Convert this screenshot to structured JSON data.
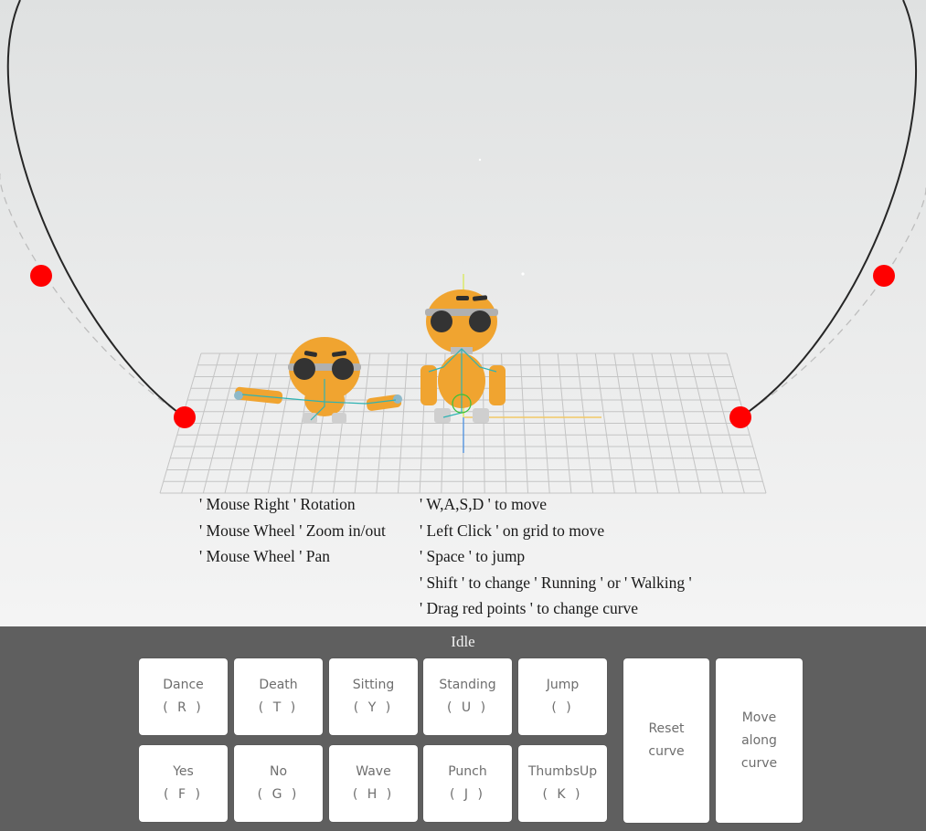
{
  "instructions": {
    "left": [
      "' Mouse Right ' Rotation",
      "' Mouse Wheel ' Zoom in/out",
      "' Mouse Wheel ' Pan"
    ],
    "right": [
      "' W,A,S,D ' to move",
      "' Left Click ' on grid to move",
      "' Space ' to jump",
      "' Shift ' to change ' Running ' or ' Walking '",
      "' Drag red points ' to change curve"
    ]
  },
  "status": "Idle",
  "actions_row1": [
    {
      "label": "Dance",
      "key": "( R )"
    },
    {
      "label": "Death",
      "key": "( T )"
    },
    {
      "label": "Sitting",
      "key": "( Y )"
    },
    {
      "label": "Standing",
      "key": "( U )"
    },
    {
      "label": "Jump",
      "key": "(  )"
    }
  ],
  "actions_row2": [
    {
      "label": "Yes",
      "key": "( F )"
    },
    {
      "label": "No",
      "key": "( G )"
    },
    {
      "label": "Wave",
      "key": "( H )"
    },
    {
      "label": "Punch",
      "key": "( J )"
    },
    {
      "label": "ThumbsUp",
      "key": "( K )"
    }
  ],
  "curve_buttons": {
    "reset": "Reset\ncurve",
    "move": "Move\nalong\ncurve"
  },
  "colors": {
    "panel": "#5f5f5f",
    "control_point": "#ff0000",
    "robot_body": "#f0a430",
    "robot_eye": "#333333",
    "grid": "#c4c4c4"
  }
}
